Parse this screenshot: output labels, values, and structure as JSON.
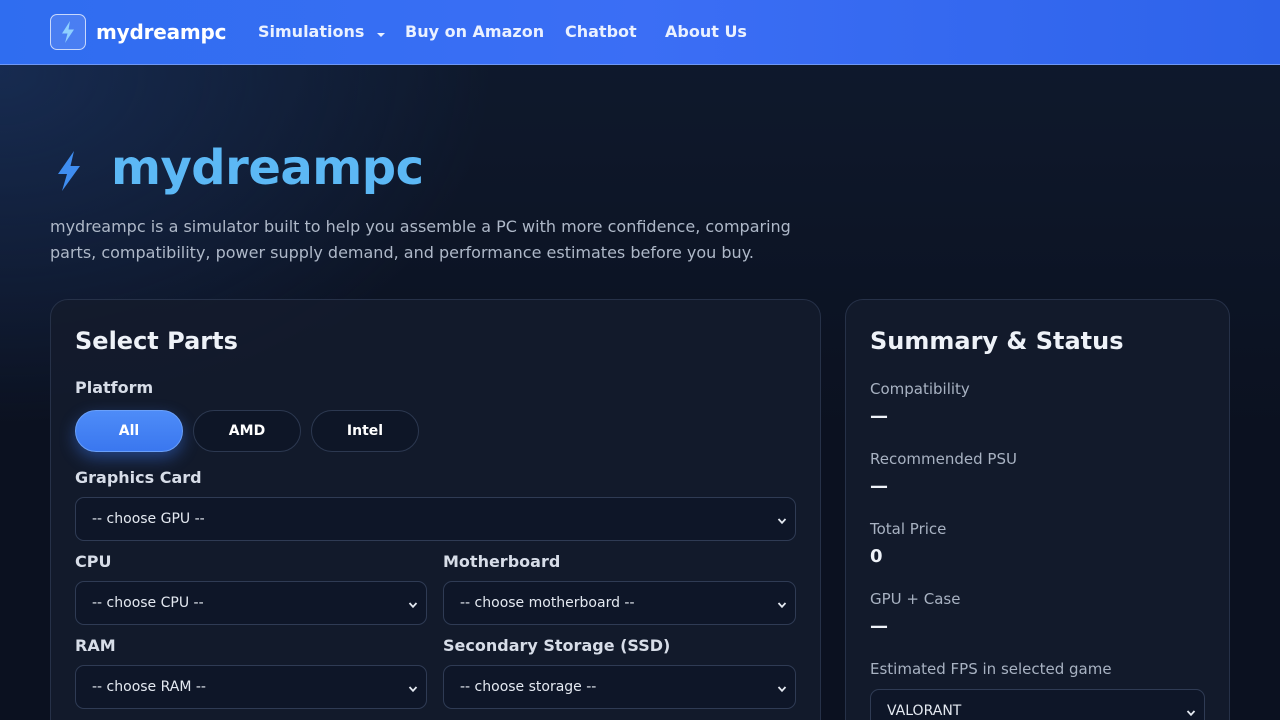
{
  "nav": {
    "brand": "mydreampc",
    "items": [
      {
        "label": "Simulations",
        "has_dropdown": true
      },
      {
        "label": "Buy on Amazon"
      },
      {
        "label": "Chatbot"
      },
      {
        "label": "About Us"
      }
    ]
  },
  "hero": {
    "title": "mydreampc",
    "description": "mydreampc is a simulator built to help you assemble a PC with more confidence, comparing parts, compatibility, power supply demand, and performance estimates before you buy."
  },
  "parts": {
    "title": "Select Parts",
    "platform_label": "Platform",
    "platform_options": [
      "All",
      "AMD",
      "Intel"
    ],
    "platform_selected": "All",
    "gpu_label": "Graphics Card",
    "gpu_value": "-- choose GPU --",
    "cpu_label": "CPU",
    "cpu_value": "-- choose CPU --",
    "motherboard_label": "Motherboard",
    "motherboard_value": "-- choose motherboard --",
    "ram_label": "RAM",
    "ram_value": "-- choose RAM --",
    "storage_label": "Secondary Storage (SSD)",
    "storage_value": "-- choose storage --"
  },
  "summary": {
    "title": "Summary & Status",
    "compatibility_label": "Compatibility",
    "compatibility_value": "—",
    "psu_label": "Recommended PSU",
    "psu_value": "—",
    "price_label": "Total Price",
    "price_value": "0",
    "gpu_case_label": "GPU + Case",
    "gpu_case_value": "—",
    "fps_label": "Estimated FPS in selected game",
    "game_value": "VALORANT"
  },
  "colors": {
    "nav_blue": "#3b6ef5",
    "accent_title": "#5cb8f5",
    "active_pill": "#4e8cf8",
    "background": "#0b1120"
  }
}
